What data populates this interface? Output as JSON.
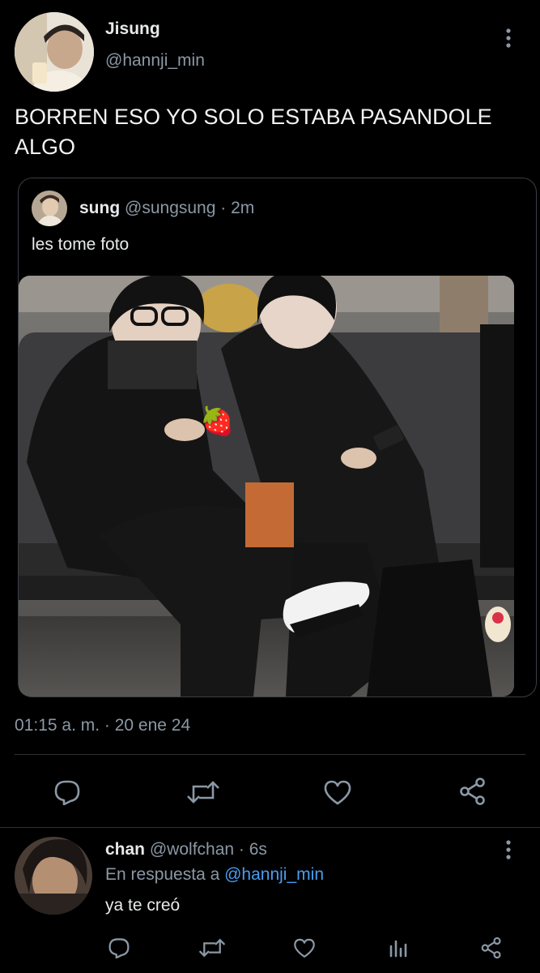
{
  "main_tweet": {
    "author_name": "Jisung",
    "author_handle": "@hannji_min",
    "text_line1": "BORREN ESO YO SOLO ESTABA PASANDOLE",
    "text_line2": "ALGO",
    "timestamp": "01:15 a. m. · 20 ene 24"
  },
  "quoted_tweet": {
    "author_name": "sung",
    "author_handle": "@sungsung",
    "time": "· 2m",
    "text": "les tome foto",
    "photo_emoji": "🍓"
  },
  "reply": {
    "author_name": "chan",
    "author_handle": "@wolfchan",
    "time": "· 6s",
    "reply_prefix": "En respuesta a",
    "reply_to": "@hannji_min",
    "text": "ya te creó"
  },
  "icons": [
    "more-vertical-icon",
    "reply-icon",
    "retweet-icon",
    "like-icon",
    "share-icon",
    "views-icon"
  ],
  "colors": {
    "background": "#000000",
    "text": "#e7e9ea",
    "muted": "#8b98a5",
    "link": "#4a9df0",
    "divider": "#2f3336"
  }
}
